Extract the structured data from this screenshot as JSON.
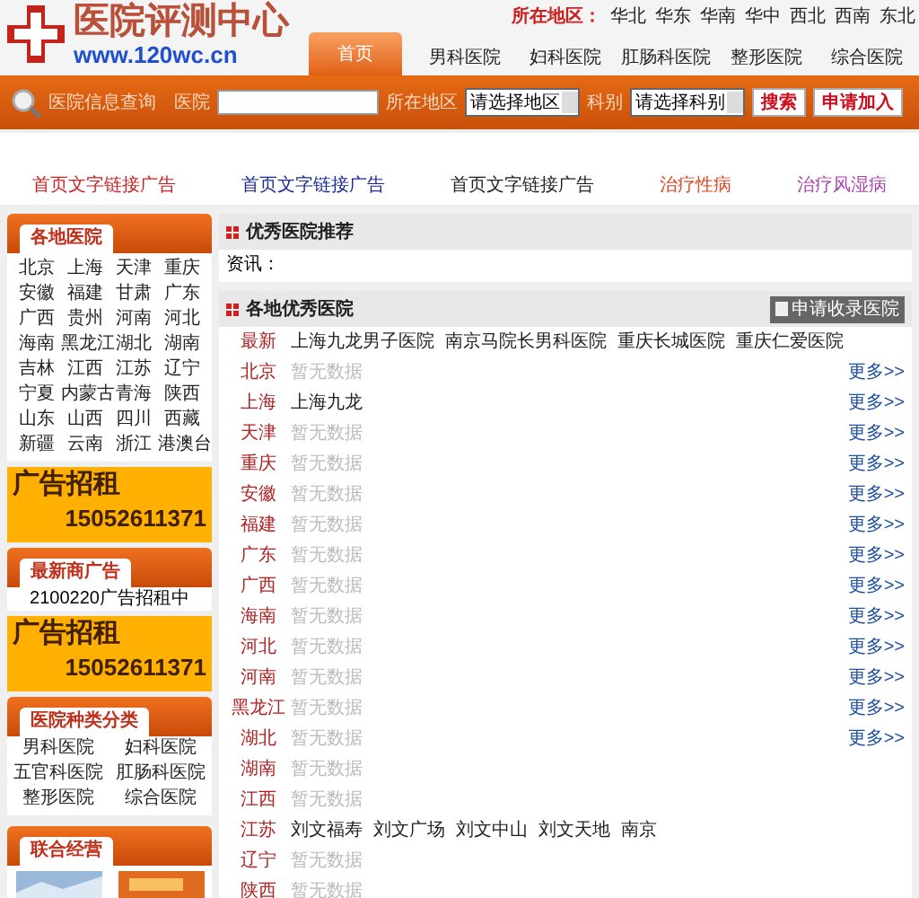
{
  "header": {
    "logo_title": "医院评测中心",
    "logo_url": "www.120wc.cn",
    "region_label": "所在地区：",
    "regions": [
      "华北",
      "华东",
      "华南",
      "华中",
      "西北",
      "西南",
      "东北"
    ]
  },
  "tabs": [
    {
      "label": "首页",
      "selected": true
    },
    {
      "label": "男科医院",
      "selected": false
    },
    {
      "label": "妇科医院",
      "selected": false
    },
    {
      "label": "肛肠科医院",
      "selected": false
    },
    {
      "label": "整形医院",
      "selected": false
    },
    {
      "label": "综合医院",
      "selected": false
    }
  ],
  "search": {
    "title": "医院信息查询",
    "hospital_label": "医院",
    "area_label": "所在地区",
    "area_value": "请选择地区",
    "dept_label": "科别",
    "dept_value": "请选择科别",
    "buttons": [
      "搜索",
      "申请加入"
    ]
  },
  "ad_links": [
    {
      "text": "首页文字链接广告",
      "color": "#cc2222"
    },
    {
      "text": "首页文字链接广告",
      "color": "#1a2a99"
    },
    {
      "text": "首页文字链接广告",
      "color": "#222222"
    },
    {
      "text": "治疗性病",
      "color": "#dd4422"
    },
    {
      "text": "治疗风湿病",
      "color": "#aa44aa"
    }
  ],
  "sidebar": {
    "regions_title": "各地医院",
    "cities": [
      "北京",
      "上海",
      "天津",
      "重庆",
      "安徽",
      "福建",
      "甘肃",
      "广东",
      "广西",
      "贵州",
      "河南",
      "河北",
      "海南",
      "黑龙江",
      "湖北",
      "湖南",
      "吉林",
      "江西",
      "江苏",
      "辽宁",
      "宁夏",
      "内蒙古",
      "青海",
      "陕西",
      "山东",
      "山西",
      "四川",
      "西藏",
      "新疆",
      "云南",
      "浙江",
      "港澳台"
    ],
    "ad1": {
      "title": "广告招租",
      "phone": "15052611371"
    },
    "merchant": {
      "title": "最新商广告",
      "text": "2100220广告招租中"
    },
    "ad2": {
      "title": "广告招租",
      "phone": "15052611371"
    },
    "categories_title": "医院种类分类",
    "categories": [
      "男科医院",
      "妇科医院",
      "五官科医院",
      "肛肠科医院",
      "整形医院",
      "综合医院"
    ],
    "partners_title": "联合经营"
  },
  "recommend": {
    "title": "优秀医院推荐",
    "text": "资讯："
  },
  "local": {
    "title": "各地优秀医院",
    "apply_button": "申请收录医院",
    "rows": [
      {
        "region": "最新",
        "hospitals": [
          "上海九龙男子医院",
          "南京马院长男科医院",
          "重庆长城医院",
          "重庆仁爱医院"
        ],
        "empty": false
      },
      {
        "region": "北京",
        "hospitals": [
          "暂无数据"
        ],
        "empty": true,
        "more": "更多>>"
      },
      {
        "region": "上海",
        "hospitals": [
          "上海九龙"
        ],
        "empty": false,
        "more": "更多>>"
      },
      {
        "region": "天津",
        "hospitals": [
          "暂无数据"
        ],
        "empty": true,
        "more": "更多>>"
      },
      {
        "region": "重庆",
        "hospitals": [
          "暂无数据"
        ],
        "empty": true,
        "more": "更多>>"
      },
      {
        "region": "安徽",
        "hospitals": [
          "暂无数据"
        ],
        "empty": true,
        "more": "更多>>"
      },
      {
        "region": "福建",
        "hospitals": [
          "暂无数据"
        ],
        "empty": true,
        "more": "更多>>"
      },
      {
        "region": "广东",
        "hospitals": [
          "暂无数据"
        ],
        "empty": true,
        "more": "更多>>"
      },
      {
        "region": "广西",
        "hospitals": [
          "暂无数据"
        ],
        "empty": true,
        "more": "更多>>"
      },
      {
        "region": "海南",
        "hospitals": [
          "暂无数据"
        ],
        "empty": true,
        "more": "更多>>"
      },
      {
        "region": "河北",
        "hospitals": [
          "暂无数据"
        ],
        "empty": true,
        "more": "更多>>"
      },
      {
        "region": "河南",
        "hospitals": [
          "暂无数据"
        ],
        "empty": true,
        "more": "更多>>"
      },
      {
        "region": "黑龙江",
        "hospitals": [
          "暂无数据"
        ],
        "empty": true,
        "more": "更多>>"
      },
      {
        "region": "湖北",
        "hospitals": [
          "暂无数据"
        ],
        "empty": true,
        "more": "更多>>"
      },
      {
        "region": "湖南",
        "hospitals": [
          "暂无数据"
        ],
        "empty": true
      },
      {
        "region": "江西",
        "hospitals": [
          "暂无数据"
        ],
        "empty": true
      },
      {
        "region": "江苏",
        "hospitals": [
          "刘文福寿",
          "刘文广场",
          "刘文中山",
          "刘文天地",
          "南京"
        ],
        "empty": false
      },
      {
        "region": "辽宁",
        "hospitals": [
          "暂无数据"
        ],
        "empty": true
      },
      {
        "region": "陕西",
        "hospitals": [
          "暂无数据"
        ],
        "empty": true
      }
    ]
  }
}
